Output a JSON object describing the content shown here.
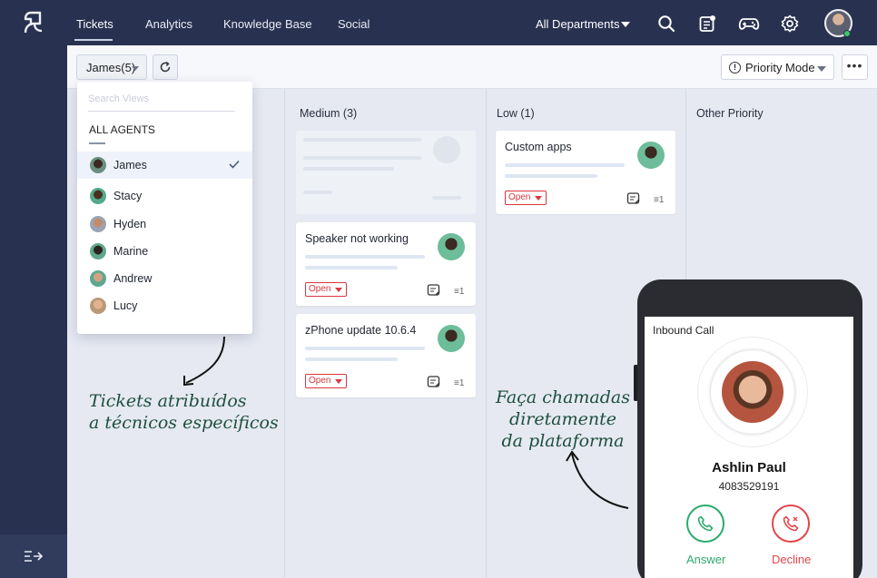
{
  "nav": {
    "tabs": [
      "Tickets",
      "Analytics",
      "Knowledge Base",
      "Social"
    ],
    "active_tab": "Tickets",
    "department": "All Departments"
  },
  "icons": {
    "logo": "app-logo-icon",
    "search": "search-icon",
    "notes": "notes-icon",
    "games": "gamepad-icon",
    "settings": "gear-icon",
    "collapse": "expand-sidebar-icon"
  },
  "toolbar": {
    "agent_filter": "James(5)",
    "view_mode": "Priority Mode",
    "more": "•••"
  },
  "dropdown": {
    "search_placeholder": "Search Views",
    "section": "ALL AGENTS",
    "agents": [
      {
        "name": "James",
        "selected": true
      },
      {
        "name": "Stacy",
        "selected": false
      },
      {
        "name": "Hyden",
        "selected": false
      },
      {
        "name": "Marine",
        "selected": false
      },
      {
        "name": "Andrew",
        "selected": false
      },
      {
        "name": "Lucy",
        "selected": false
      }
    ]
  },
  "columns": [
    {
      "title": "Medium (3)"
    },
    {
      "title": "Low (1)"
    },
    {
      "title": "Other Priority"
    }
  ],
  "tickets": [
    {
      "title": "Speaker not working",
      "status": "Open",
      "count": "1"
    },
    {
      "title": "zPhone update 10.6.4",
      "status": "Open",
      "count": "1"
    },
    {
      "title": "Custom apps",
      "status": "Open",
      "count": "1"
    }
  ],
  "annotations": {
    "left_line1": "Tickets atribuídos",
    "left_line2": "a técnicos específicos",
    "right_line1": "Faça chamadas",
    "right_line2": "diretamente",
    "right_line3": "da plataforma"
  },
  "call": {
    "title": "Inbound Call",
    "caller_name": "Ashlin Paul",
    "caller_number": "4083529191",
    "answer_label": "Answer",
    "decline_label": "Decline"
  },
  "colors": {
    "nav_bg": "#283250",
    "board_bg": "#e6e9f2",
    "open_badge": "#d9363e",
    "answer": "#2bab6b",
    "decline": "#e2474d",
    "handwriting": "#1d4f3c"
  }
}
